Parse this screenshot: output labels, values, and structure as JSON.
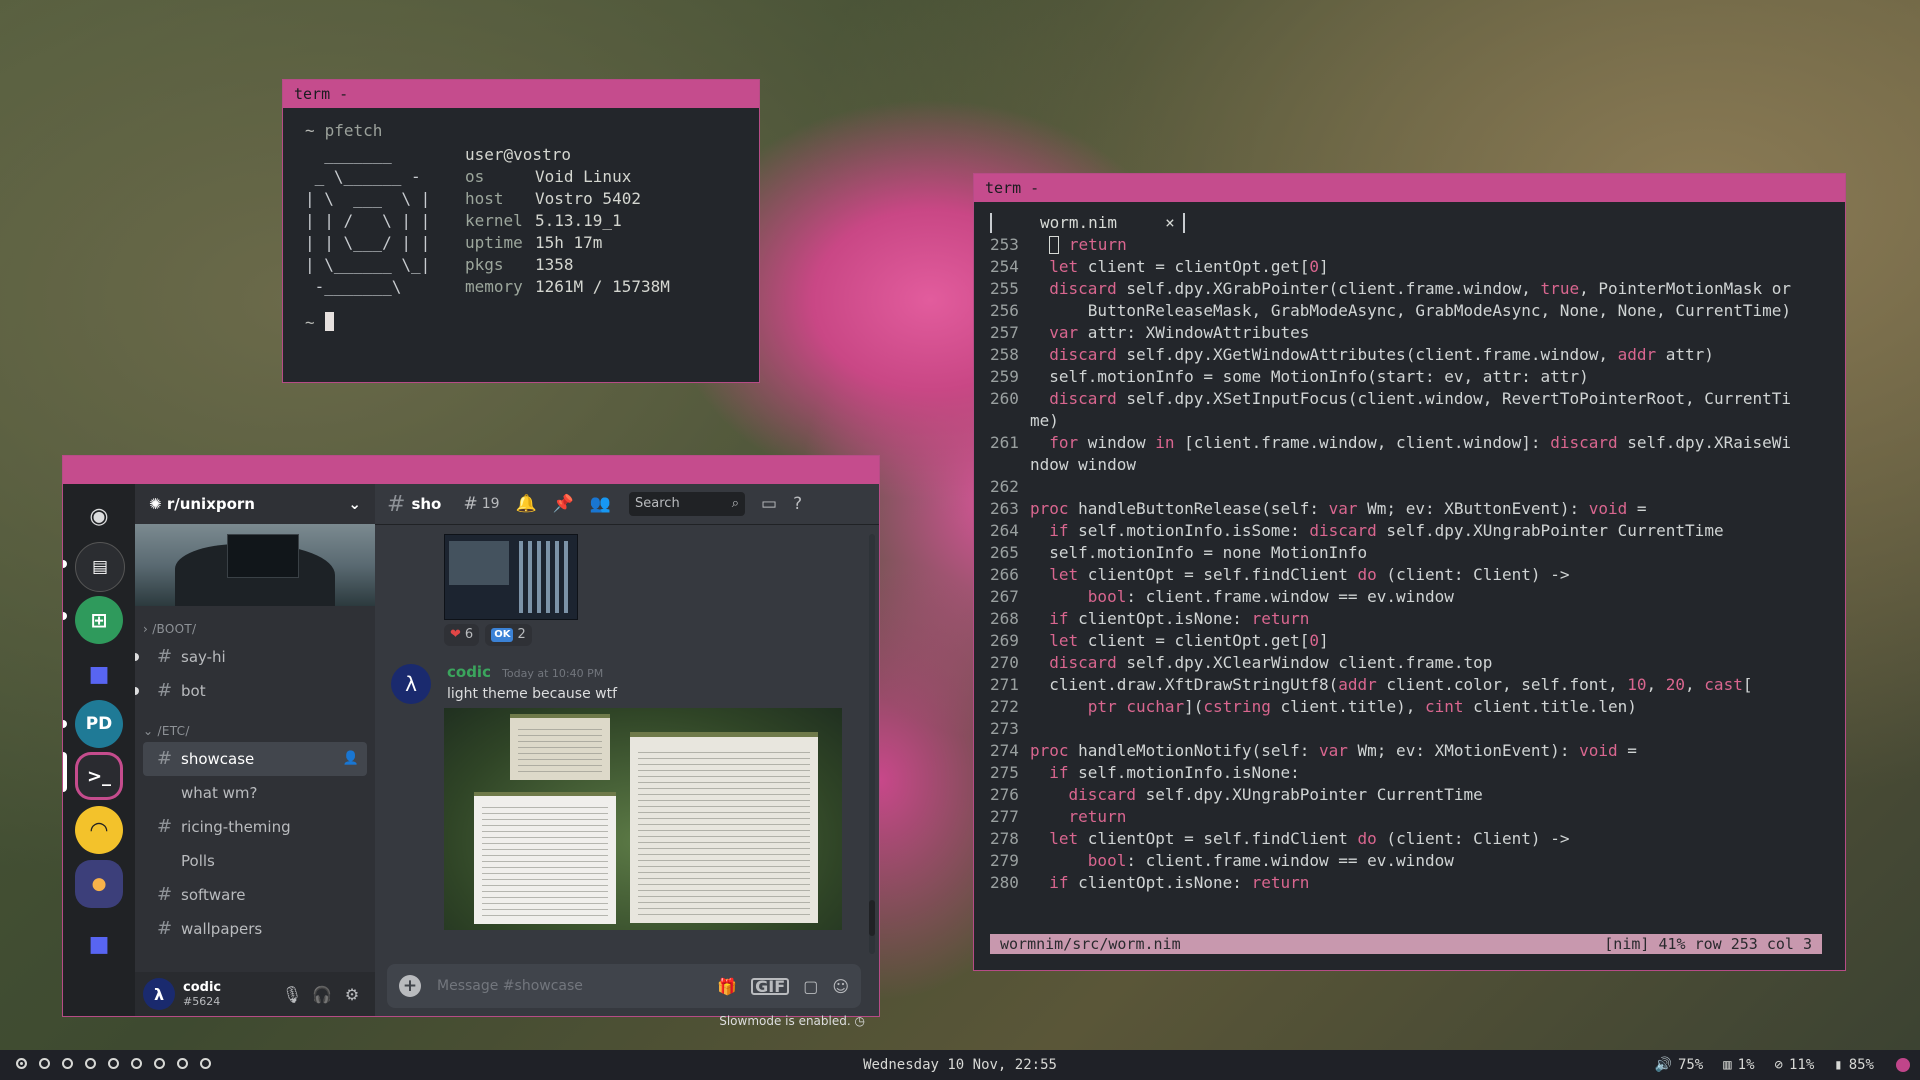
{
  "term1": {
    "title": "term -",
    "prompt": "~",
    "command": "pfetch",
    "art": "  _______\n _ \\______ -\n| \\  ___  \\ |\n| | /   \\ | |\n| | \\___/ | |\n| \\______ \\_|\n -_______\\",
    "user_host": "user@vostro",
    "info": [
      {
        "k": "os",
        "v": "Void Linux"
      },
      {
        "k": "host",
        "v": "Vostro 5402"
      },
      {
        "k": "kernel",
        "v": "5.13.19_1"
      },
      {
        "k": "uptime",
        "v": "15h 17m"
      },
      {
        "k": "pkgs",
        "v": "1358"
      },
      {
        "k": "memory",
        "v": "1261M / 15738M"
      }
    ]
  },
  "term2": {
    "title": "term -",
    "tab_name": "worm.nim",
    "tab_close": "×",
    "status_left": "wormnim/src/worm.nim",
    "status_right": "[nim] 41% row 253 col 3",
    "lines": [
      {
        "no": "253",
        "html": "  <span class=\"cur\"></span> <span class=\"kw\">return</span>"
      },
      {
        "no": "254",
        "html": "  <span class=\"kw\">let</span> client = clientOpt.get[<span class=\"num\">0</span>]"
      },
      {
        "no": "255",
        "html": "  <span class=\"kw\">discard</span> self.dpy.XGrabPointer(client.frame.window, <span class=\"kw\">true</span>, PointerMotionMask or"
      },
      {
        "no": "256",
        "html": "      ButtonReleaseMask, GrabModeAsync, GrabModeAsync, None, None, CurrentTime)"
      },
      {
        "no": "257",
        "html": "  <span class=\"kw\">var</span> attr: XWindowAttributes"
      },
      {
        "no": "258",
        "html": "  <span class=\"kw\">discard</span> self.dpy.XGetWindowAttributes(client.frame.window, <span class=\"kw\">addr</span> attr)"
      },
      {
        "no": "259",
        "html": "  self.motionInfo = some MotionInfo(start: ev, attr: attr)"
      },
      {
        "no": "260",
        "html": "  <span class=\"kw\">discard</span> self.dpy.XSetInputFocus(client.window, RevertToPointerRoot, CurrentTi"
      },
      {
        "no": "",
        "html": "me)"
      },
      {
        "no": "261",
        "html": "  <span class=\"kw\">for</span> window <span class=\"kw\">in</span> [client.frame.window, client.window]: <span class=\"kw\">discard</span> self.dpy.XRaiseWi"
      },
      {
        "no": "",
        "html": "ndow window"
      },
      {
        "no": "262",
        "html": ""
      },
      {
        "no": "263",
        "html": "<span class=\"kw\">proc</span> handleButtonRelease(self: <span class=\"kw\">var</span> Wm; ev: XButtonEvent): <span class=\"kw\">void</span> ="
      },
      {
        "no": "264",
        "html": "  <span class=\"kw\">if</span> self.motionInfo.isSome: <span class=\"kw\">discard</span> self.dpy.XUngrabPointer CurrentTime"
      },
      {
        "no": "265",
        "html": "  self.motionInfo = none MotionInfo"
      },
      {
        "no": "266",
        "html": "  <span class=\"kw\">let</span> clientOpt = self.findClient <span class=\"kw\">do</span> (client: Client) -&gt;"
      },
      {
        "no": "267",
        "html": "      <span class=\"kw\">bool</span>: client.frame.window == ev.window"
      },
      {
        "no": "268",
        "html": "  <span class=\"kw\">if</span> clientOpt.isNone: <span class=\"kw\">return</span>"
      },
      {
        "no": "269",
        "html": "  <span class=\"kw\">let</span> client = clientOpt.get[<span class=\"num\">0</span>]"
      },
      {
        "no": "270",
        "html": "  <span class=\"kw\">discard</span> self.dpy.XClearWindow client.frame.top"
      },
      {
        "no": "271",
        "html": "  client.draw.XftDrawStringUtf8(<span class=\"kw\">addr</span> client.color, self.font, <span class=\"num\">10</span>, <span class=\"num\">20</span>, <span class=\"kw\">cast</span>["
      },
      {
        "no": "272",
        "html": "      <span class=\"kw\">ptr</span> <span class=\"kw\">cuchar</span>](<span class=\"kw\">cstring</span> client.title), <span class=\"kw\">cint</span> client.title.len)"
      },
      {
        "no": "273",
        "html": ""
      },
      {
        "no": "274",
        "html": "<span class=\"kw\">proc</span> handleMotionNotify(self: <span class=\"kw\">var</span> Wm; ev: XMotionEvent): <span class=\"kw\">void</span> ="
      },
      {
        "no": "275",
        "html": "  <span class=\"kw\">if</span> self.motionInfo.isNone:"
      },
      {
        "no": "276",
        "html": "    <span class=\"kw\">discard</span> self.dpy.XUngrabPointer CurrentTime"
      },
      {
        "no": "277",
        "html": "    <span class=\"kw\">return</span>"
      },
      {
        "no": "278",
        "html": "  <span class=\"kw\">let</span> clientOpt = self.findClient <span class=\"kw\">do</span> (client: Client) -&gt;"
      },
      {
        "no": "279",
        "html": "      <span class=\"kw\">bool</span>: client.frame.window == ev.window"
      },
      {
        "no": "280",
        "html": "  <span class=\"kw\">if</span> clientOpt.isNone: <span class=\"kw\">return</span>"
      }
    ]
  },
  "discord": {
    "server_name": "r/unixporn",
    "categories": [
      "/BOOT/",
      "/ETC/"
    ],
    "boot_channels": [
      "say-hi",
      "bot"
    ],
    "etc_channels": [
      {
        "name": "showcase",
        "type": "text",
        "active": true
      },
      {
        "name": "what wm?",
        "type": "thread"
      },
      {
        "name": "ricing-theming",
        "type": "text"
      },
      {
        "name": "Polls",
        "type": "thread"
      },
      {
        "name": "software",
        "type": "text"
      },
      {
        "name": "wallpapers",
        "type": "text"
      }
    ],
    "guild_labels": {
      "pd": "PD"
    },
    "user": {
      "name": "codic",
      "tag": "#5624",
      "avatar": "λ"
    },
    "chat": {
      "channel": "sho",
      "thread_count": "19",
      "search_placeholder": "Search",
      "reactions": [
        {
          "emoji": "❤",
          "count": "6"
        },
        {
          "emoji": "OK",
          "count": "2"
        }
      ],
      "message": {
        "author": "codic",
        "time": "Today at 10:40 PM",
        "text": "light theme because wtf",
        "avatar": "λ"
      },
      "composer_placeholder": "Message #showcase",
      "gif_label": "GIF",
      "slowmode": "Slowmode is enabled."
    }
  },
  "bar": {
    "workspaces": 9,
    "clock": "Wednesday 10 Nov, 22:55",
    "volume": "75%",
    "cpu": "1%",
    "disk": "11%",
    "battery": "85%"
  },
  "colors": {
    "accent": "#c54c8d",
    "term_bg": "#23262b",
    "keyword": "#d9668f",
    "discord_green": "#3ba55d"
  }
}
